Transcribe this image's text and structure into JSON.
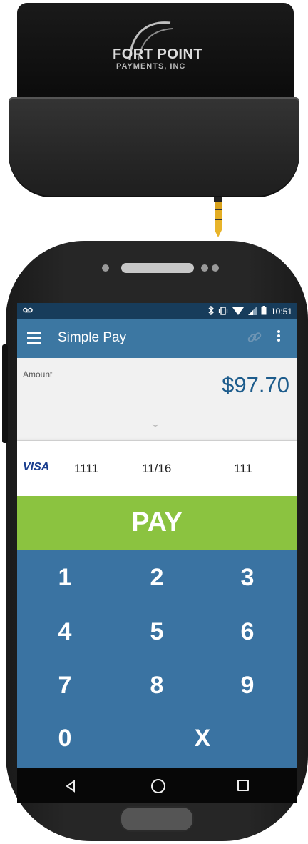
{
  "reader": {
    "logo_line1": "FORT POINT",
    "logo_line2": "PAYMENTS, INC"
  },
  "status_bar": {
    "left_icon": "voicemail-icon",
    "icons": [
      "bluetooth-icon",
      "vibrate-icon",
      "wifi-icon",
      "signal-icon",
      "battery-icon"
    ],
    "time": "10:51"
  },
  "app_bar": {
    "title": "Simple Pay",
    "menu_icon": "hamburger-icon",
    "action_icons": [
      "link-icon",
      "more-vert-icon"
    ]
  },
  "amount": {
    "label": "Amount",
    "value": "$97.70"
  },
  "card": {
    "brand": "VISA",
    "number": "1111",
    "expiry": "11/16",
    "cvv": "111"
  },
  "pay_button": {
    "label": "PAY"
  },
  "keypad": {
    "keys": [
      "1",
      "2",
      "3",
      "4",
      "5",
      "6",
      "7",
      "8",
      "9",
      "0",
      "X"
    ]
  },
  "nav_bar": {
    "icons": [
      "back-icon",
      "home-icon",
      "recents-icon"
    ]
  },
  "colors": {
    "status_bar": "#173c5b",
    "app_bar": "#3c77a2",
    "pay_button": "#8bc340",
    "keypad": "#3a73a2",
    "amount_text": "#1d5c8c"
  }
}
